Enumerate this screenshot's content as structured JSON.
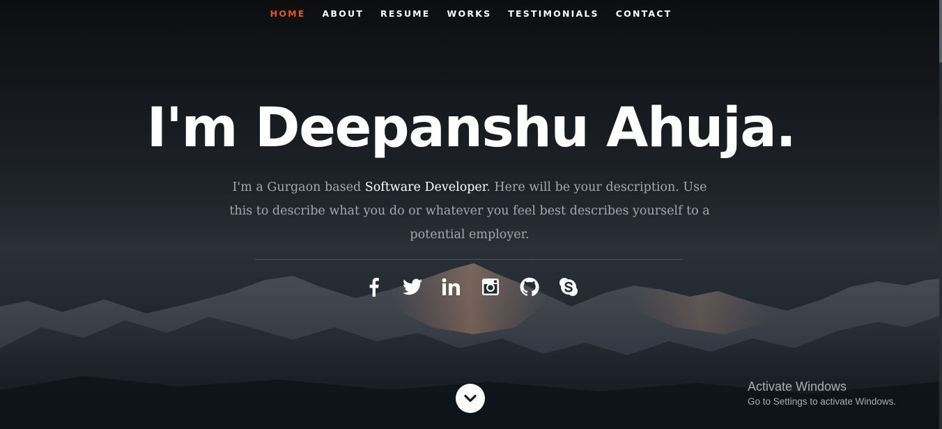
{
  "nav": {
    "items": [
      {
        "label": "HOME",
        "active": true
      },
      {
        "label": "ABOUT",
        "active": false
      },
      {
        "label": "RESUME",
        "active": false
      },
      {
        "label": "WORKS",
        "active": false
      },
      {
        "label": "TESTIMONIALS",
        "active": false
      },
      {
        "label": "CONTACT",
        "active": false
      }
    ]
  },
  "hero": {
    "headline": "I'm Deepanshu Ahuja.",
    "intro_before": "I'm a Gurgaon based ",
    "intro_highlight": "Software Developer",
    "intro_after": ". Here will be your description. Use this to describe what you do or whatever you feel best describes yourself to a potential employer."
  },
  "social": {
    "icons": [
      "facebook-icon",
      "twitter-icon",
      "linkedin-icon",
      "instagram-icon",
      "github-icon",
      "skype-icon"
    ]
  },
  "scroll_down": {
    "icon": "chevron-down-icon"
  },
  "watermark": {
    "title": "Activate Windows",
    "subtitle": "Go to Settings to activate Windows."
  },
  "colors": {
    "accent": "#e5571f",
    "text": "#ffffff",
    "muted_text": "#a8a8a8"
  }
}
